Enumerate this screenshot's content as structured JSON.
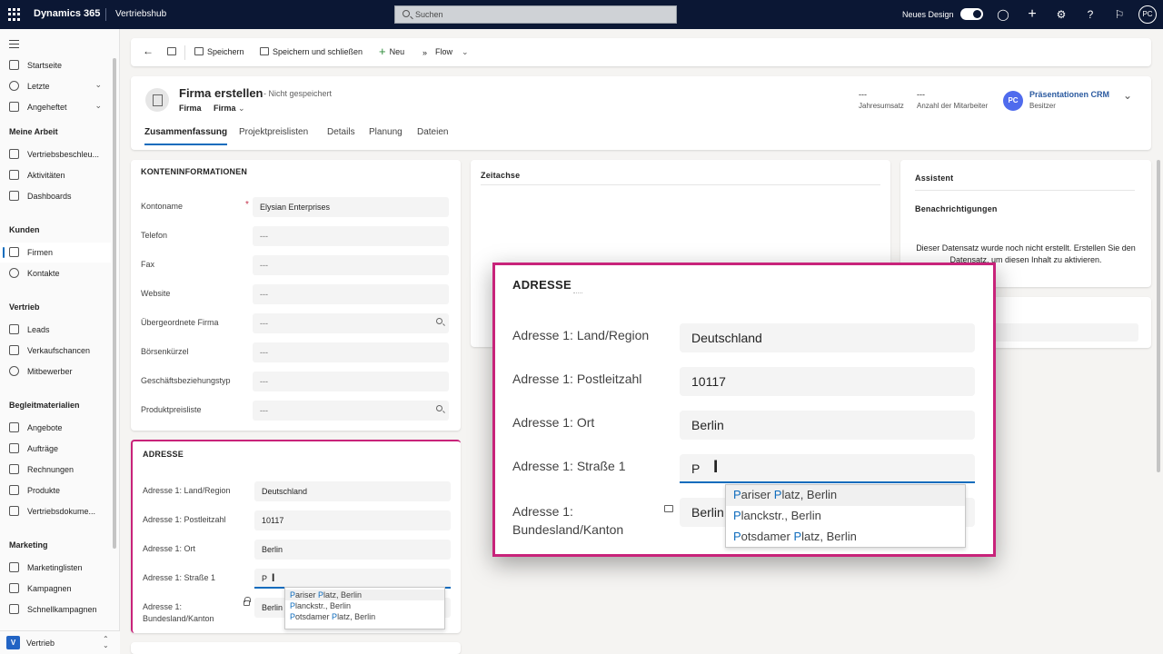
{
  "topbar": {
    "brand": "Dynamics 365",
    "app": "Vertriebshub",
    "search_placeholder": "Suchen",
    "new_design_label": "Neues Design",
    "user_initials": "PC"
  },
  "sidebar": {
    "items_top": [
      {
        "label": "Startseite"
      },
      {
        "label": "Letzte"
      },
      {
        "label": "Angeheftet"
      }
    ],
    "sections": [
      {
        "title": "Meine Arbeit",
        "items": [
          "Vertriebsbeschleu...",
          "Aktivitäten",
          "Dashboards"
        ]
      },
      {
        "title": "Kunden",
        "items": [
          "Firmen",
          "Kontakte"
        ]
      },
      {
        "title": "Vertrieb",
        "items": [
          "Leads",
          "Verkaufschancen",
          "Mitbewerber"
        ]
      },
      {
        "title": "Begleitmaterialien",
        "items": [
          "Angebote",
          "Aufträge",
          "Rechnungen",
          "Produkte",
          "Vertriebsdokume..."
        ]
      },
      {
        "title": "Marketing",
        "items": [
          "Marketinglisten",
          "Kampagnen",
          "Schnellkampagnen"
        ]
      }
    ],
    "area": {
      "initial": "V",
      "label": "Vertrieb"
    }
  },
  "commandbar": {
    "save": "Speichern",
    "save_close": "Speichern und schließen",
    "new": "Neu",
    "flow": "Flow"
  },
  "header": {
    "title": "Firma erstellen",
    "subtitle": "- Nicht gespeichert",
    "entity": "Firma",
    "form": "Firma",
    "fields": [
      {
        "value": "---",
        "label": "Jahresumsatz"
      },
      {
        "value": "---",
        "label": "Anzahl der Mitarbeiter"
      }
    ],
    "owner": {
      "initials": "PC",
      "name": "Präsentationen CRM",
      "role": "Besitzer"
    },
    "tabs": [
      "Zusammenfassung",
      "Projektpreislisten",
      "Details",
      "Planung",
      "Dateien"
    ]
  },
  "account_info": {
    "title": "KONTENINFORMATIONEN",
    "fields": [
      {
        "label": "Kontoname",
        "value": "Elysian Enterprises",
        "required": true
      },
      {
        "label": "Telefon",
        "value": "---"
      },
      {
        "label": "Fax",
        "value": "---"
      },
      {
        "label": "Website",
        "value": "---"
      },
      {
        "label": "Übergeordnete Firma",
        "value": "---",
        "lookup": true
      },
      {
        "label": "Börsenkürzel",
        "value": "---"
      },
      {
        "label": "Geschäftsbeziehungstyp",
        "value": "---"
      },
      {
        "label": "Produktpreisliste",
        "value": "---",
        "lookup": true
      }
    ]
  },
  "address": {
    "title": "ADRESSE",
    "fields": [
      {
        "label": "Adresse 1: Land/Region",
        "value": "Deutschland"
      },
      {
        "label": "Adresse 1: Postleitzahl",
        "value": "10117"
      },
      {
        "label": "Adresse 1: Ort",
        "value": "Berlin"
      },
      {
        "label": "Adresse 1: Straße 1",
        "value": "P"
      },
      {
        "label": "Adresse 1: Bundesland/Kanton",
        "value": "Berlin"
      }
    ],
    "suggestions": [
      {
        "pre": "",
        "match": "P",
        "post": "ariser ",
        "match2": "P",
        "post2": "latz, Berlin"
      },
      {
        "pre": "",
        "match": "P",
        "post": "lanckstr., Berlin",
        "match2": "",
        "post2": ""
      },
      {
        "pre": "",
        "match": "P",
        "post": "otsdamer ",
        "match2": "P",
        "post2": "latz, Berlin"
      }
    ]
  },
  "timeline": {
    "title": "Zeitachse"
  },
  "assistant": {
    "title": "Assistent",
    "notifications": "Benachrichtigungen",
    "message": "Dieser Datensatz wurde noch nicht erstellt. Erstellen Sie den Datensatz, um diesen Inhalt zu aktivieren."
  },
  "colors": {
    "accent": "#0f6cbd",
    "highlight_border": "#c8237a",
    "topbar": "#0b1734"
  }
}
